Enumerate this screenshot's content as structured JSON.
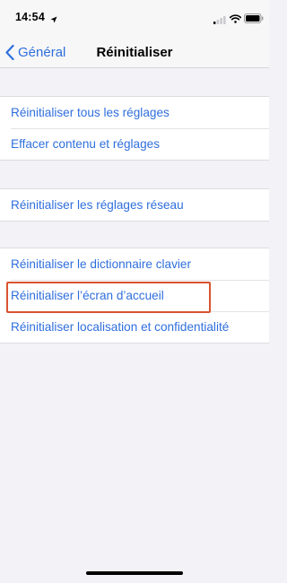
{
  "status_bar": {
    "time": "14:54",
    "icons": [
      "location-arrow-icon",
      "cellular-signal-icon",
      "wifi-icon",
      "battery-icon"
    ]
  },
  "nav": {
    "back_label": "Général",
    "title": "Réinitialiser"
  },
  "groups": [
    {
      "items": [
        {
          "label": "Réinitialiser tous les réglages"
        },
        {
          "label": "Effacer contenu et réglages"
        }
      ]
    },
    {
      "items": [
        {
          "label": "Réinitialiser les réglages réseau"
        }
      ]
    },
    {
      "items": [
        {
          "label": "Réinitialiser le dictionnaire clavier"
        },
        {
          "label": "Réinitialiser l’écran d’accueil",
          "highlighted": true
        },
        {
          "label": "Réinitialiser localisation et confidentialité"
        }
      ]
    }
  ],
  "colors": {
    "accent": "#2f6fdc",
    "highlight_border": "#d9532e",
    "background": "#f2f2f7"
  }
}
